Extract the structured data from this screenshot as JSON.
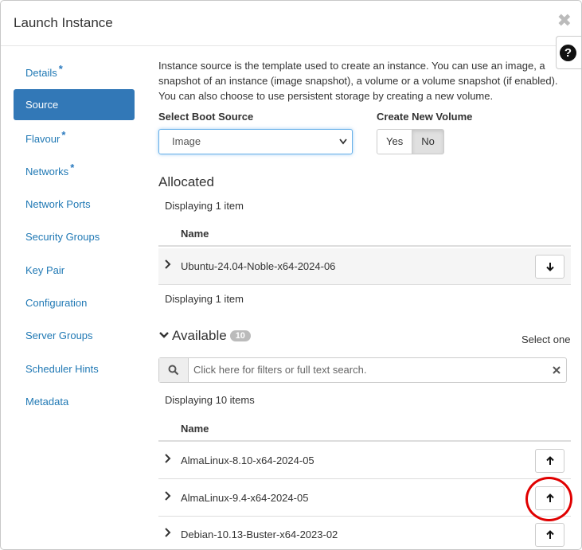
{
  "modal": {
    "title": "Launch Instance",
    "close_glyph": "✖",
    "help_glyph": "?"
  },
  "sidebar": {
    "items": [
      {
        "label": "Details",
        "required": "*"
      },
      {
        "label": "Source",
        "required": ""
      },
      {
        "label": "Flavour",
        "required": "*"
      },
      {
        "label": "Networks",
        "required": "*"
      },
      {
        "label": "Network Ports",
        "required": ""
      },
      {
        "label": "Security Groups",
        "required": ""
      },
      {
        "label": "Key Pair",
        "required": ""
      },
      {
        "label": "Configuration",
        "required": ""
      },
      {
        "label": "Server Groups",
        "required": ""
      },
      {
        "label": "Scheduler Hints",
        "required": ""
      },
      {
        "label": "Metadata",
        "required": ""
      }
    ],
    "active_index": 1
  },
  "source": {
    "intro": "Instance source is the template used to create an instance. You can use an image, a snapshot of an instance (image snapshot), a volume or a volume snapshot (if enabled). You can also choose to use persistent storage by creating a new volume.",
    "boot_source_label": "Select Boot Source",
    "boot_source_value": "Image",
    "create_volume_label": "Create New Volume",
    "yes_label": "Yes",
    "no_label": "No",
    "selected_toggle": "No"
  },
  "allocated": {
    "title": "Allocated",
    "display_count_top": "Displaying 1 item",
    "column_name": "Name",
    "rows": [
      {
        "name": "Ubuntu-24.04-Noble-x64-2024-06"
      }
    ],
    "display_count_bottom": "Displaying 1 item"
  },
  "available": {
    "title": "Available",
    "count": "10",
    "select_hint": "Select one",
    "search_placeholder": "Click here for filters or full text search.",
    "display_count": "Displaying 10 items",
    "column_name": "Name",
    "rows": [
      {
        "name": "AlmaLinux-8.10-x64-2024-05"
      },
      {
        "name": "AlmaLinux-9.4-x64-2024-05"
      },
      {
        "name": "Debian-10.13-Buster-x64-2023-02"
      }
    ]
  },
  "colors": {
    "primary": "#3278b7",
    "link": "#1f78b4",
    "highlight_circle": "#e00000"
  }
}
